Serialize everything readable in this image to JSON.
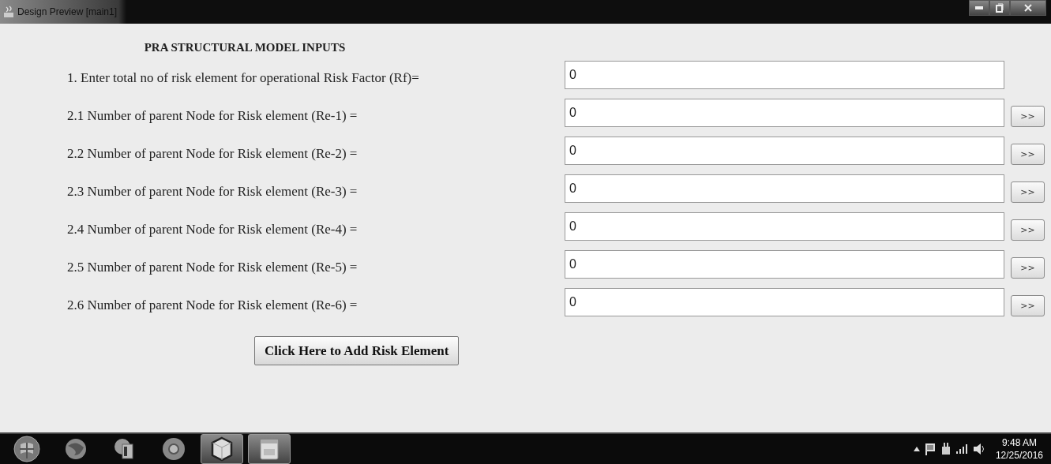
{
  "window": {
    "title": "Design Preview [main1]"
  },
  "form": {
    "heading": "PRA STRUCTURAL MODEL INPUTS",
    "rows": [
      {
        "kind": "total",
        "label": "1. Enter total no of risk element for operational Risk Factor (Rf)=",
        "value": "0"
      },
      {
        "kind": "parent",
        "label": "2.1 Number of parent Node for Risk element (Re-1) =",
        "value": "0",
        "button": ">>"
      },
      {
        "kind": "parent",
        "label": "2.2  Number of parent Node for Risk element (Re-2) =",
        "value": "0",
        "button": ">>"
      },
      {
        "kind": "parent",
        "label": "2.3  Number of parent Node for Risk element (Re-3) =",
        "value": "0",
        "button": ">>"
      },
      {
        "kind": "parent",
        "label": "2.4  Number of parent Node for Risk element (Re-4) =",
        "value": "0",
        "button": ">>"
      },
      {
        "kind": "parent",
        "label": "2.5  Number of parent Node for Risk element (Re-5) =",
        "value": "0",
        "button": ">>"
      },
      {
        "kind": "parent",
        "label": "2.6  Number of parent Node for Risk element (Re-6) =",
        "value": "0",
        "button": ">>"
      }
    ],
    "submit": "Click Here to Add Risk Element"
  },
  "taskbar": {
    "items": [
      {
        "kind": "start",
        "active": false
      },
      {
        "kind": "browser",
        "active": false
      },
      {
        "kind": "explorer",
        "active": false
      },
      {
        "kind": "chrome",
        "active": false
      },
      {
        "kind": "cube",
        "active": true
      },
      {
        "kind": "files",
        "active": true
      }
    ],
    "clock": {
      "time": "9:48 AM",
      "date": "12/25/2016"
    }
  }
}
